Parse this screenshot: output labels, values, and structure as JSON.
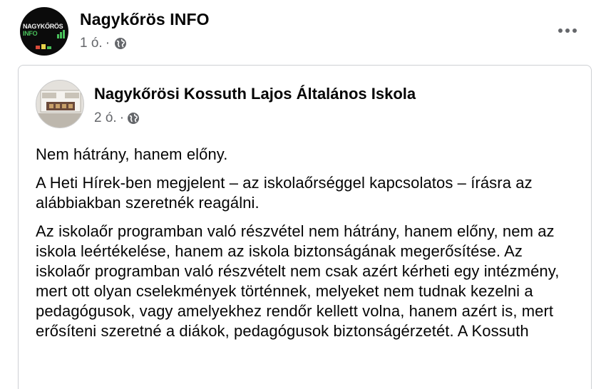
{
  "post": {
    "author": "Nagykőrös INFO",
    "time": "1 ó.",
    "separator": "·",
    "privacy_icon": "globe-icon",
    "more_icon": "more-options-icon",
    "avatar": {
      "line1": "NAGYKŐRÖS",
      "line2": "INFO",
      "accent_color": "#49c05a"
    }
  },
  "shared": {
    "author": "Nagykőrösi Kossuth Lajos Általános Iskola",
    "time": "2 ó.",
    "separator": "·",
    "privacy_icon": "globe-icon",
    "paragraphs": [
      "Nem hátrány, hanem előny.",
      "A Heti Hírek-ben megjelent – az iskolaőrséggel kapcsolatos – írásra az alábbiakban szeretnék reagálni.",
      "Az iskolaőr programban való részvétel nem hátrány, hanem előny, nem az iskola leértékelése, hanem az iskola biztonságának megerősítése. Az iskolaőr programban való részvételt nem csak azért kérheti egy intézmény, mert ott olyan cselekmények történnek, melyeket nem tudnak kezelni a pedagógusok, vagy amelyekhez rendőr kellett volna, hanem azért is, mert erősíteni szeretné a diákok, pedagógusok biztonságérzetét. A Kossuth"
    ]
  },
  "colors": {
    "text": "#050505",
    "meta": "#65676b",
    "border": "#ced0d4"
  }
}
